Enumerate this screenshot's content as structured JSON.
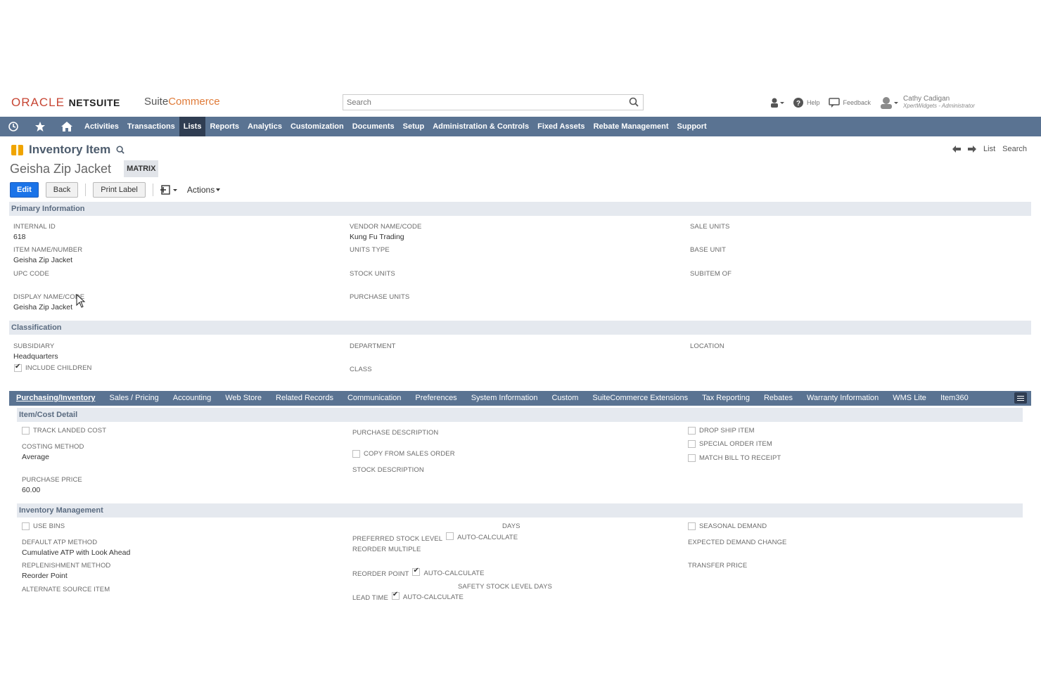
{
  "header": {
    "oracle": "ORACLE",
    "netsuite": "NETSUITE",
    "suite": "Suite",
    "commerce": "Commerce",
    "search_placeholder": "Search",
    "help": "Help",
    "feedback": "Feedback",
    "user_name": "Cathy Cadigan",
    "user_role": "XpertWidgets - Administrator"
  },
  "nav": {
    "items": [
      "Activities",
      "Transactions",
      "Lists",
      "Reports",
      "Analytics",
      "Customization",
      "Documents",
      "Setup",
      "Administration & Controls",
      "Fixed Assets",
      "Rebate Management",
      "Support"
    ],
    "active": "Lists"
  },
  "page": {
    "title": "Inventory Item",
    "record_name": "Geisha Zip Jacket",
    "badge": "MATRIX",
    "list_link": "List",
    "search_link": "Search"
  },
  "buttons": {
    "edit": "Edit",
    "back": "Back",
    "print_label": "Print Label",
    "actions": "Actions"
  },
  "primary": {
    "header": "Primary Information",
    "internal_id_label": "INTERNAL ID",
    "internal_id": "618",
    "item_name_label": "ITEM NAME/NUMBER",
    "item_name": "Geisha Zip Jacket",
    "upc_label": "UPC CODE",
    "display_name_label": "DISPLAY NAME/CODE",
    "display_name": "Geisha Zip Jacket",
    "vendor_label": "VENDOR NAME/CODE",
    "vendor": "Kung Fu Trading",
    "units_type_label": "UNITS TYPE",
    "stock_units_label": "STOCK UNITS",
    "purchase_units_label": "PURCHASE UNITS",
    "sale_units_label": "SALE UNITS",
    "base_unit_label": "BASE UNIT",
    "subitem_label": "SUBITEM OF"
  },
  "classification": {
    "header": "Classification",
    "subsidiary_label": "SUBSIDIARY",
    "subsidiary": "Headquarters",
    "include_children": "INCLUDE CHILDREN",
    "department_label": "DEPARTMENT",
    "class_label": "CLASS",
    "location_label": "LOCATION"
  },
  "subtabs": [
    "Purchasing/Inventory",
    "Sales / Pricing",
    "Accounting",
    "Web Store",
    "Related Records",
    "Communication",
    "Preferences",
    "System Information",
    "Custom",
    "SuiteCommerce Extensions",
    "Tax Reporting",
    "Rebates",
    "Warranty Information",
    "WMS Lite",
    "Item360"
  ],
  "cost": {
    "header": "Item/Cost Detail",
    "track_landed": "TRACK LANDED COST",
    "costing_label": "COSTING METHOD",
    "costing": "Average",
    "purchase_price_label": "PURCHASE PRICE",
    "purchase_price": "60.00",
    "purchase_desc_label": "PURCHASE DESCRIPTION",
    "copy_from_so": "COPY FROM SALES ORDER",
    "stock_desc_label": "STOCK DESCRIPTION",
    "drop_ship": "DROP SHIP ITEM",
    "special_order": "SPECIAL ORDER ITEM",
    "match_bill": "MATCH BILL TO RECEIPT"
  },
  "inventory": {
    "header": "Inventory Management",
    "use_bins": "USE BINS",
    "atp_label": "DEFAULT ATP METHOD",
    "atp": "Cumulative ATP with Look Ahead",
    "replenishment_label": "REPLENISHMENT METHOD",
    "replenishment": "Reorder Point",
    "alt_source_label": "ALTERNATE SOURCE ITEM",
    "days_label": "DAYS",
    "preferred_stock_label": "PREFERRED STOCK LEVEL",
    "auto_calculate": "AUTO-CALCULATE",
    "reorder_multiple_label": "REORDER MULTIPLE",
    "reorder_point_label": "REORDER POINT",
    "safety_stock_label": "SAFETY STOCK LEVEL DAYS",
    "lead_time_label": "LEAD TIME",
    "seasonal_demand": "SEASONAL DEMAND",
    "expected_demand_label": "EXPECTED DEMAND CHANGE",
    "transfer_price_label": "TRANSFER PRICE"
  }
}
